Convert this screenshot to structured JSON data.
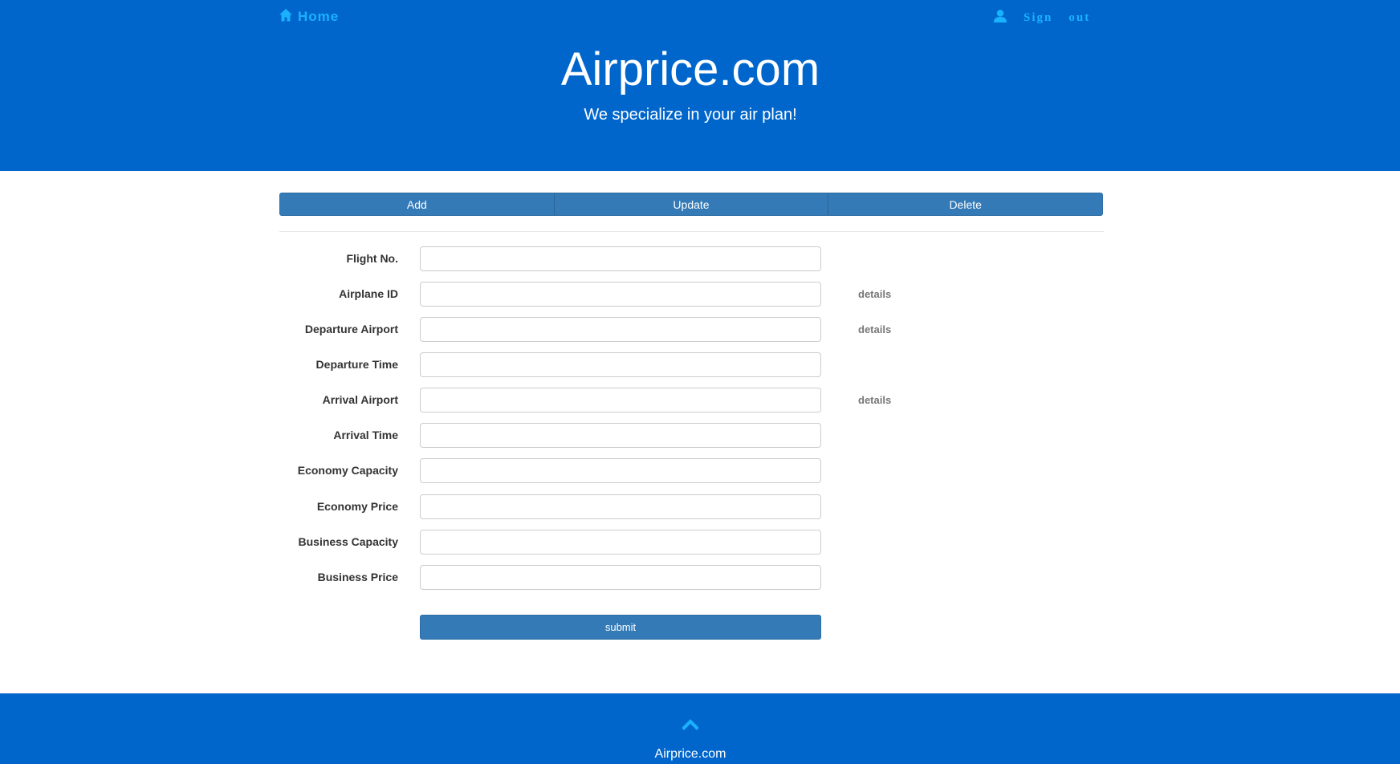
{
  "nav": {
    "home_label": "Home",
    "signout_word1": "Sign",
    "signout_word2": "out"
  },
  "header": {
    "title": "Airprice.com",
    "subtitle": "We specialize in your air plan!"
  },
  "tabs": [
    {
      "label": "Add"
    },
    {
      "label": "Update"
    },
    {
      "label": "Delete"
    }
  ],
  "form": {
    "fields": [
      {
        "label": "Flight No.",
        "value": "",
        "details": ""
      },
      {
        "label": "Airplane ID",
        "value": "",
        "details": "details"
      },
      {
        "label": "Departure Airport",
        "value": "",
        "details": "details"
      },
      {
        "label": "Departure Time",
        "value": "",
        "details": ""
      },
      {
        "label": "Arrival Airport",
        "value": "",
        "details": "details"
      },
      {
        "label": "Arrival Time",
        "value": "",
        "details": ""
      },
      {
        "label": "Economy Capacity",
        "value": "",
        "details": ""
      },
      {
        "label": "Economy Price",
        "value": "",
        "details": ""
      },
      {
        "label": "Business Capacity",
        "value": "",
        "details": ""
      },
      {
        "label": "Business Price",
        "value": "",
        "details": ""
      }
    ],
    "submit_label": "submit"
  },
  "footer": {
    "brand": "Airprice.com",
    "up_icon": "chevron-up-icon"
  },
  "colors": {
    "brand_blue": "#0066cc",
    "link_cyan": "#1ab2ff",
    "button_blue": "#337ab7"
  }
}
